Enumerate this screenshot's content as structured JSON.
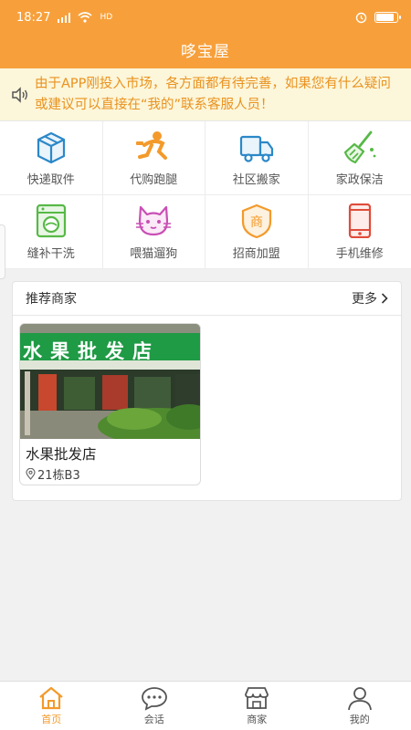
{
  "status_bar": {
    "time": "18:27",
    "network": "HD"
  },
  "header": {
    "title": "哆宝屋"
  },
  "notice": {
    "text": "由于APP刚投入市场，各方面都有待完善，如果您有什么疑问或建议可以直接在“我的”联系客服人员！"
  },
  "services": [
    {
      "label": "快递取件",
      "icon": "package-icon"
    },
    {
      "label": "代购跑腿",
      "icon": "runner-icon"
    },
    {
      "label": "社区搬家",
      "icon": "truck-icon"
    },
    {
      "label": "家政保洁",
      "icon": "broom-icon"
    },
    {
      "label": "缝补干洗",
      "icon": "washing-machine-icon"
    },
    {
      "label": "喂猫遛狗",
      "icon": "cat-icon"
    },
    {
      "label": "招商加盟",
      "icon": "shop-badge-icon"
    },
    {
      "label": "手机维修",
      "icon": "phone-icon"
    }
  ],
  "recommend": {
    "title": "推荐商家",
    "more_label": "更多",
    "shops": [
      {
        "sign": "水果批发店",
        "name": "水果批发店",
        "location": "21栋B3"
      }
    ]
  },
  "tabbar": {
    "items": [
      {
        "label": "首页",
        "icon": "home-icon",
        "active": true
      },
      {
        "label": "会话",
        "icon": "chat-icon",
        "active": false
      },
      {
        "label": "商家",
        "icon": "store-icon",
        "active": false
      },
      {
        "label": "我的",
        "icon": "user-icon",
        "active": false
      }
    ]
  },
  "colors": {
    "primary": "#f7a03b",
    "notice_text": "#e9921e",
    "notice_bg": "#fcf6da"
  }
}
